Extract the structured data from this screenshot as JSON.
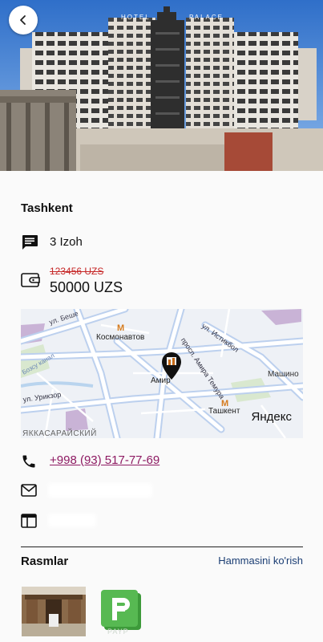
{
  "header": {
    "back_icon": "arrow-back-icon",
    "photo_signage": {
      "left": "HOTEL",
      "right": "PALACE"
    }
  },
  "details": {
    "city": "Tashkent",
    "comments_icon": "comment-icon",
    "comments": "3 Izoh",
    "price_icon": "wallet-icon",
    "old_price": "123456 UZS",
    "price": "50000 UZS"
  },
  "map": {
    "labels": {
      "street_top": "ул. Беше",
      "metro_1": "Космонавтов",
      "prospect": "просп. Амира Темура",
      "street_right": "ул. Истикбол",
      "poi": "Амир",
      "district_right": "Машино",
      "street_left": "ул. Урикзор",
      "metro_2": "Ташкент",
      "district_bottom": "ЯККАСАРАЙСКИЙ",
      "canal": "Бозсу канал",
      "brand": "Яндекс"
    }
  },
  "contacts": {
    "phone_icon": "phone-icon",
    "phone": "+998 (93) 517-77-69",
    "email_icon": "mail-icon",
    "website_icon": "web-icon"
  },
  "gallery": {
    "title": "Rasmlar",
    "see_all": "Hammasini ko'rish",
    "thumb_caption": "PAYP"
  },
  "colors": {
    "accent_link": "#8e1b63",
    "price_old": "#c62828",
    "see_all": "#1a3d73",
    "sky": "#3f7fd1",
    "logo_green": "#57b952"
  }
}
